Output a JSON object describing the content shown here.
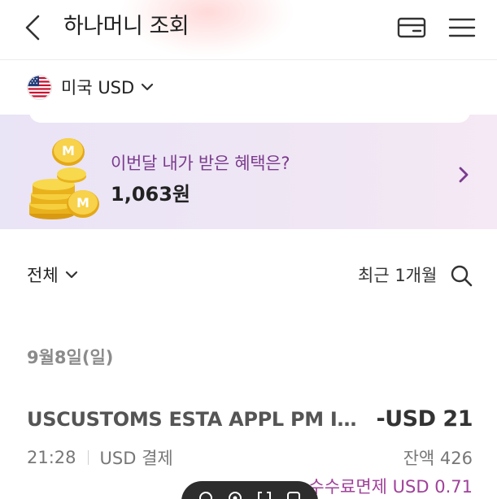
{
  "header": {
    "title": "하나머니 조회",
    "back_icon": "chevron-left-icon",
    "card_icon": "credit-card-icon",
    "menu_icon": "hamburger-menu-icon"
  },
  "currency": {
    "flag_icon": "us-flag-icon",
    "label": "미국 USD",
    "dropdown_icon": "chevron-down-icon"
  },
  "banner": {
    "question": "이번달 내가 받은 혜택은?",
    "amount": "1,063원",
    "arrow_icon": "chevron-right-icon",
    "accent_color": "#7b3b8e"
  },
  "filter": {
    "type_label": "전체",
    "period_label": "최근 1개월",
    "search_icon": "search-icon"
  },
  "transactions": [
    {
      "date": "9월8일(일)",
      "merchant": "USCUSTOMS ESTA APPL PM IND…",
      "amount": "-USD 21",
      "time": "21:28",
      "method": "USD 결제",
      "balance": "잔액 426",
      "fee": "수수료면제 USD 0.71"
    }
  ],
  "floating_bar": {
    "icons": [
      "circle-icon",
      "target-icon",
      "brackets-icon",
      "square-icon"
    ]
  }
}
